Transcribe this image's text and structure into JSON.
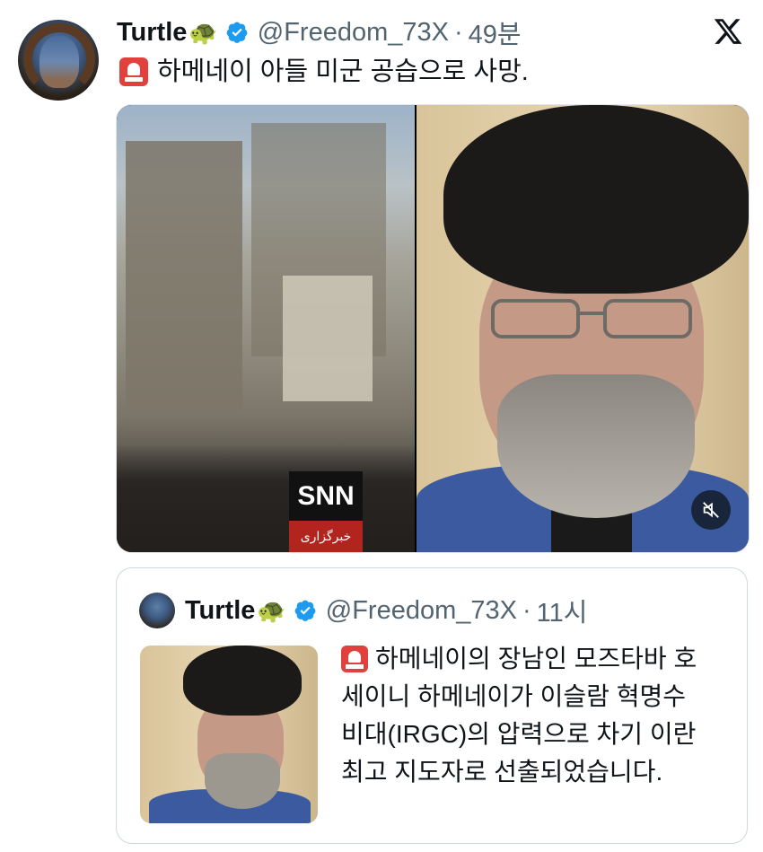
{
  "tweet": {
    "author_name": "Turtle",
    "author_emoji": "🐢",
    "handle": "@Freedom_73X",
    "separator": "·",
    "time": "49분",
    "text": "하메네이 아들 미군 공습으로 사망.",
    "video_logo": "SNN",
    "video_logo_sub": "خبرگزاری"
  },
  "icons": {
    "verified": "verified-badge-icon",
    "x_logo": "x-logo-icon",
    "siren": "siren-emoji-icon",
    "mute": "mute-icon"
  },
  "colors": {
    "verified_blue": "#1d9bf0",
    "secondary_text": "#536471",
    "border": "#cfd9de"
  },
  "quote": {
    "author_name": "Turtle",
    "author_emoji": "🐢",
    "handle": "@Freedom_73X",
    "separator": "·",
    "time": "11시",
    "lines": [
      "하메네이의 장남인 모즈타바 호",
      "세이니 하메네이가 이슬람 혁명수",
      "비대(IRGC)의 압력으로 차기 이란",
      "최고 지도자로 선출되었습니다."
    ]
  }
}
